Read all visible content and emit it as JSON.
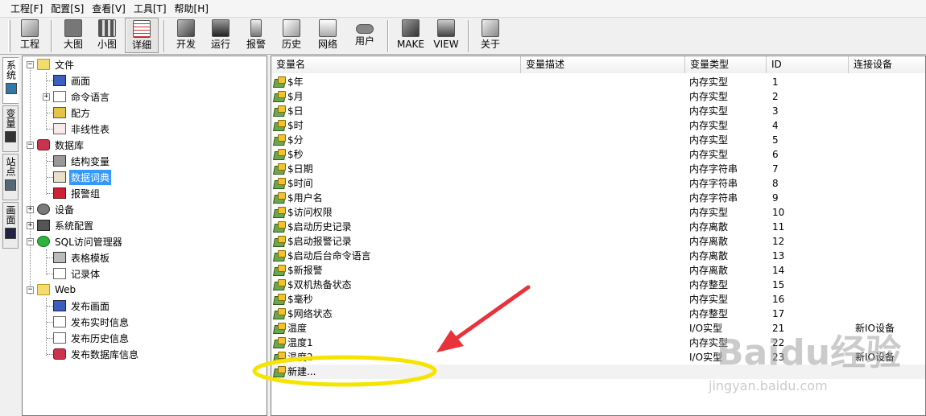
{
  "menu": [
    "工程[F]",
    "配置[S]",
    "查看[V]",
    "工具[T]",
    "帮助[H]"
  ],
  "toolbar": {
    "group1": [
      {
        "label": "工程",
        "icon": "project-icon"
      }
    ],
    "group2": [
      {
        "label": "大图",
        "icon": "large-icons-view-icon"
      },
      {
        "label": "小图",
        "icon": "small-icons-view-icon"
      },
      {
        "label": "详细",
        "icon": "details-view-icon"
      }
    ],
    "group3": [
      {
        "label": "开发",
        "icon": "develop-icon"
      },
      {
        "label": "运行",
        "icon": "run-icon"
      },
      {
        "label": "报警",
        "icon": "alarm-icon"
      },
      {
        "label": "历史",
        "icon": "history-icon"
      },
      {
        "label": "网络",
        "icon": "network-icon"
      },
      {
        "label": "用户",
        "icon": "user-key-icon"
      }
    ],
    "group4": [
      {
        "label": "MAKE",
        "icon": "make-icon"
      },
      {
        "label": "VIEW",
        "icon": "view-icon"
      }
    ],
    "group5": [
      {
        "label": "关于",
        "icon": "about-icon"
      }
    ]
  },
  "side_tabs": [
    {
      "label": "系统",
      "icon": "system-icon"
    },
    {
      "label": "变量",
      "icon": "variable-icon"
    },
    {
      "label": "站点",
      "icon": "station-icon"
    },
    {
      "label": "画面",
      "icon": "screen-icon"
    }
  ],
  "tree": {
    "file": {
      "label": "文件",
      "children": [
        "画面",
        "命令语言",
        "配方",
        "非线性表"
      ]
    },
    "database": {
      "label": "数据库",
      "children": [
        "结构变量",
        "数据词典",
        "报警组"
      ]
    },
    "device": "设备",
    "sysconfig": "系统配置",
    "sql": {
      "label": "SQL访问管理器",
      "children": [
        "表格模板",
        "记录体"
      ]
    },
    "web": {
      "label": "Web",
      "children": [
        "发布画面",
        "发布实时信息",
        "发布历史信息",
        "发布数据库信息"
      ]
    }
  },
  "columns": [
    "变量名",
    "变量描述",
    "变量类型",
    "ID",
    "连接设备"
  ],
  "rows": [
    {
      "name": "$年",
      "desc": "",
      "type": "内存实型",
      "id": "1",
      "device": ""
    },
    {
      "name": "$月",
      "desc": "",
      "type": "内存实型",
      "id": "2",
      "device": ""
    },
    {
      "name": "$日",
      "desc": "",
      "type": "内存实型",
      "id": "3",
      "device": ""
    },
    {
      "name": "$时",
      "desc": "",
      "type": "内存实型",
      "id": "4",
      "device": ""
    },
    {
      "name": "$分",
      "desc": "",
      "type": "内存实型",
      "id": "5",
      "device": ""
    },
    {
      "name": "$秒",
      "desc": "",
      "type": "内存实型",
      "id": "6",
      "device": ""
    },
    {
      "name": "$日期",
      "desc": "",
      "type": "内存字符串",
      "id": "7",
      "device": ""
    },
    {
      "name": "$时间",
      "desc": "",
      "type": "内存字符串",
      "id": "8",
      "device": ""
    },
    {
      "name": "$用户名",
      "desc": "",
      "type": "内存字符串",
      "id": "9",
      "device": ""
    },
    {
      "name": "$访问权限",
      "desc": "",
      "type": "内存实型",
      "id": "10",
      "device": ""
    },
    {
      "name": "$启动历史记录",
      "desc": "",
      "type": "内存离散",
      "id": "11",
      "device": ""
    },
    {
      "name": "$启动报警记录",
      "desc": "",
      "type": "内存离散",
      "id": "12",
      "device": ""
    },
    {
      "name": "$启动后台命令语言",
      "desc": "",
      "type": "内存离散",
      "id": "13",
      "device": ""
    },
    {
      "name": "$新报警",
      "desc": "",
      "type": "内存离散",
      "id": "14",
      "device": ""
    },
    {
      "name": "$双机热备状态",
      "desc": "",
      "type": "内存整型",
      "id": "15",
      "device": ""
    },
    {
      "name": "$毫秒",
      "desc": "",
      "type": "内存实型",
      "id": "16",
      "device": ""
    },
    {
      "name": "$网络状态",
      "desc": "",
      "type": "内存整型",
      "id": "17",
      "device": ""
    },
    {
      "name": "温度",
      "desc": "",
      "type": "I/O实型",
      "id": "21",
      "device": "新IO设备"
    },
    {
      "name": "温度1",
      "desc": "",
      "type": "内存实型",
      "id": "22",
      "device": ""
    },
    {
      "name": "温度2",
      "desc": "",
      "type": "I/O实型",
      "id": "23",
      "device": "新IO设备"
    }
  ],
  "new_item": "新建...",
  "watermark": {
    "brand": "Baidu经验",
    "url": "jingyan.baidu.com"
  },
  "colors": {
    "selection": "#3399ff",
    "annotation_arrow": "#e8333a",
    "annotation_ellipse": "#f5e400"
  }
}
